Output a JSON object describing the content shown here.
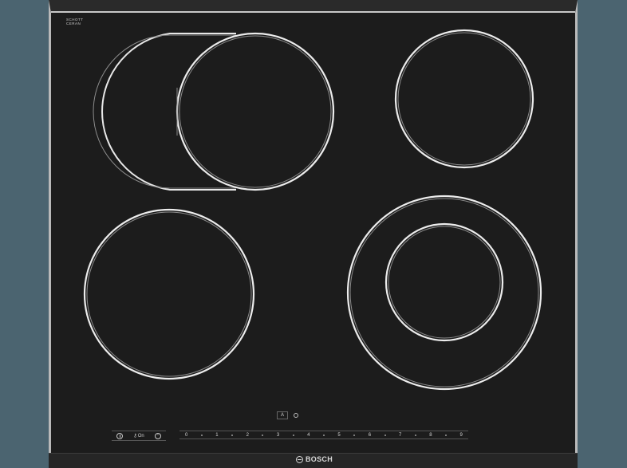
{
  "brand": {
    "name": "BOSCH",
    "glass_line1": "SCHOTT",
    "glass_line2": "CERAN"
  },
  "controls": {
    "power_label": "",
    "child_lock_label": "On",
    "timer_label": "",
    "boost_label": "A"
  },
  "slider": {
    "levels": [
      "0",
      "1",
      "2",
      "3",
      "4",
      "5",
      "6",
      "7",
      "8",
      "9"
    ]
  },
  "colors": {
    "glass": "#1c1c1c",
    "frame": "#b9b9b9",
    "zone_ring": "#e8e8e8",
    "background": "#4b6470"
  }
}
